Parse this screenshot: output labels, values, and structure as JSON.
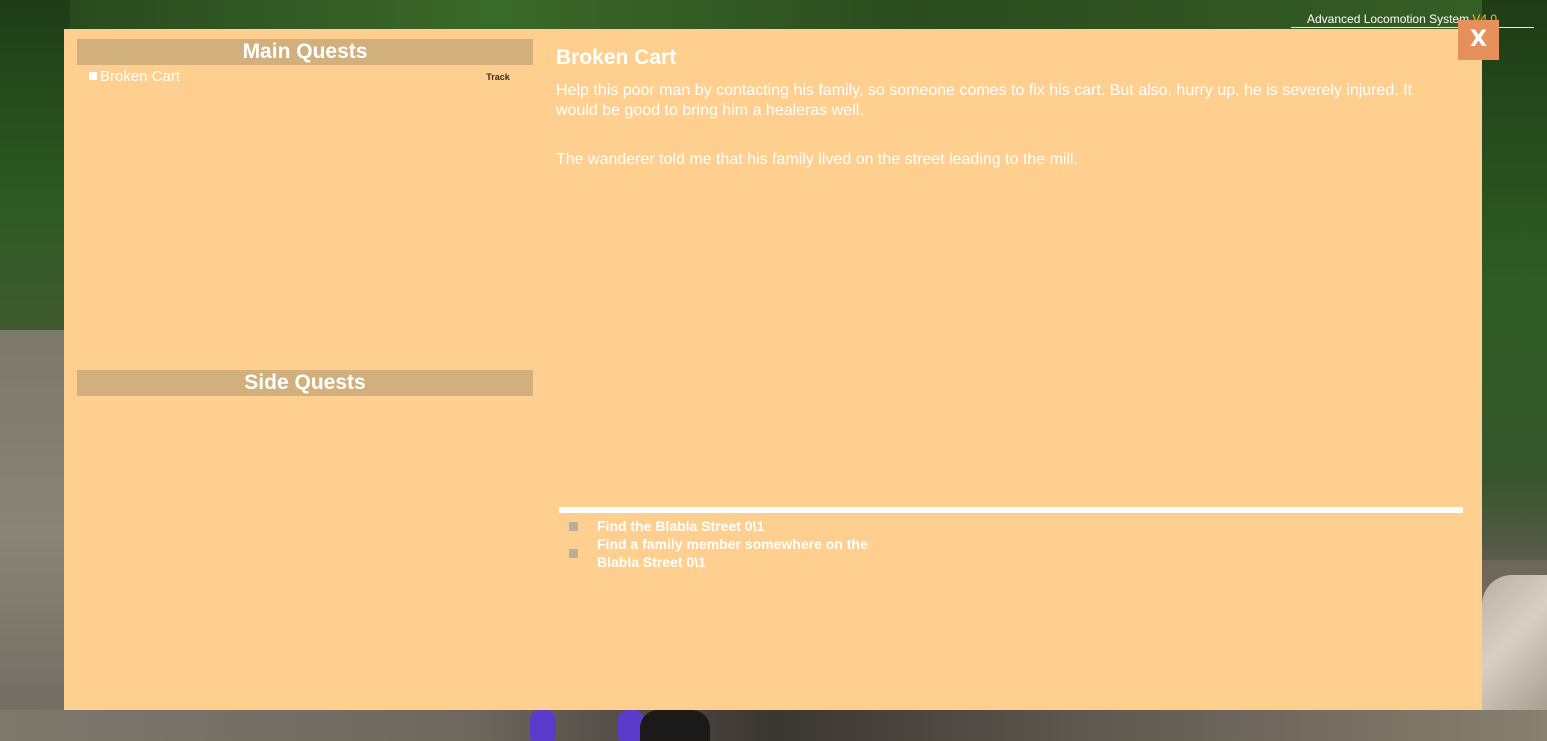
{
  "hud": {
    "app_name": "Advanced Locomotion System ",
    "version": "V4.0"
  },
  "quest_log": {
    "main_header": "Main Quests",
    "side_header": "Side Quests",
    "main_quests": [
      {
        "name": "Broken Cart",
        "track_label": "Track"
      }
    ],
    "side_quests": [],
    "close_label": "X"
  },
  "detail": {
    "title": "Broken Cart",
    "description": "Help this poor man by contacting his family, so someone comes to fix his cart. But also, hurry up, he is severely injured. It would be good to  bring him a healeras well.",
    "note": "The wanderer told me that his family lived on the street leading to the mill.",
    "objectives": [
      {
        "text": "Find the Blabla Street 0\\1"
      },
      {
        "text": "Find a family member somewhere on the Blabla Street 0\\1"
      }
    ]
  },
  "colors": {
    "panel": "#fecf8e",
    "header_bar": "#d2b07d",
    "close_button": "#e6905c",
    "version_accent": "#f2c230"
  }
}
